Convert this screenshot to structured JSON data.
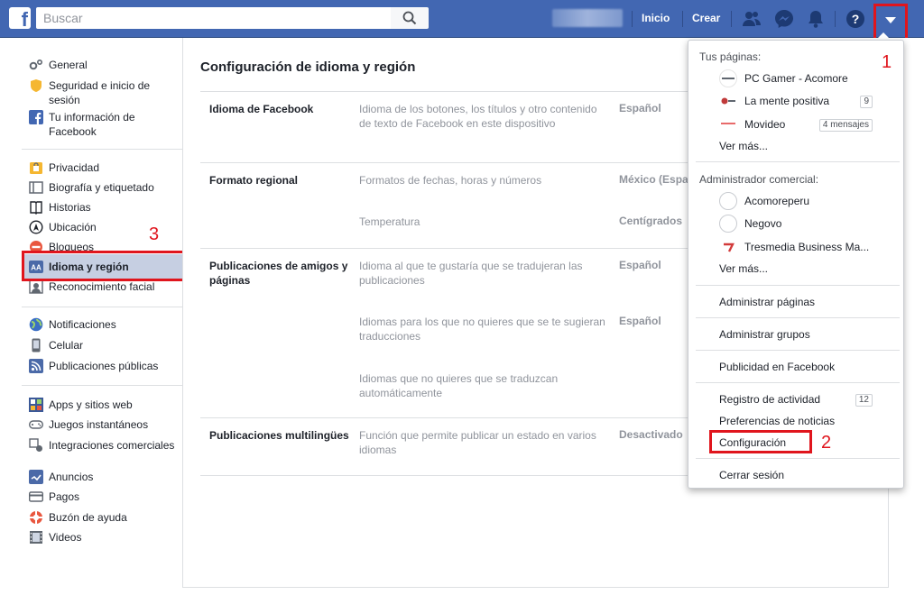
{
  "topbar": {
    "logo": "f",
    "search_placeholder": "Buscar",
    "nav_home": "Inicio",
    "nav_create": "Crear",
    "icons": [
      "friends-icon",
      "messenger-icon",
      "notifications-icon",
      "help-icon",
      "dropdown-caret-icon"
    ]
  },
  "sidebar": {
    "group1": [
      {
        "label": "General",
        "icon": "gear-icon"
      },
      {
        "label": "Seguridad e inicio de sesión",
        "icon": "shield-icon"
      },
      {
        "label": "Tu información de Facebook",
        "icon": "facebook-icon"
      }
    ],
    "group2": [
      {
        "label": "Privacidad",
        "icon": "lock-icon"
      },
      {
        "label": "Biografía y etiquetado",
        "icon": "timeline-icon"
      },
      {
        "label": "Historias",
        "icon": "book-icon"
      },
      {
        "label": "Ubicación",
        "icon": "location-icon"
      },
      {
        "label": "Bloqueos",
        "icon": "block-icon"
      },
      {
        "label": "Idioma y región",
        "icon": "language-icon"
      },
      {
        "label": "Reconocimiento facial",
        "icon": "face-icon"
      }
    ],
    "group3": [
      {
        "label": "Notificaciones",
        "icon": "globe-icon"
      },
      {
        "label": "Celular",
        "icon": "phone-icon"
      },
      {
        "label": "Publicaciones públicas",
        "icon": "rss-icon"
      }
    ],
    "group4": [
      {
        "label": "Apps y sitios web",
        "icon": "apps-icon"
      },
      {
        "label": "Juegos instantáneos",
        "icon": "gamepad-icon"
      },
      {
        "label": "Integraciones comerciales",
        "icon": "integration-icon"
      },
      {
        "label": "Anuncios",
        "icon": "ads-icon"
      },
      {
        "label": "Pagos",
        "icon": "card-icon"
      },
      {
        "label": "Buzón de ayuda",
        "icon": "lifebuoy-icon"
      },
      {
        "label": "Videos",
        "icon": "film-icon"
      }
    ]
  },
  "main": {
    "title": "Configuración de idioma y región",
    "rows": [
      {
        "label": "Idioma de Facebook",
        "desc": "Idioma de los botones, los títulos y otro contenido de texto de Facebook en este dispositivo",
        "value": "Español"
      },
      {
        "label": "Formato regional",
        "desc": "Formatos de fechas, horas y números",
        "value": "México (Español)"
      },
      {
        "label": "",
        "desc": "Temperatura",
        "value": "Centígrados"
      },
      {
        "label": "Publicaciones de amigos y páginas",
        "desc": "Idioma al que te gustaría que se tradujeran las publicaciones",
        "value": "Español"
      },
      {
        "label": "",
        "desc": "Idiomas para los que no quieres que se te sugieran traducciones",
        "value": "Español"
      },
      {
        "label": "",
        "desc": "Idiomas que no quieres que se traduzcan automáticamente",
        "value": ""
      },
      {
        "label": "Publicaciones multilingües",
        "desc": "Función que permite publicar un estado en varios idiomas",
        "value": "Desactivado"
      }
    ]
  },
  "menu": {
    "pages_heading": "Tus páginas:",
    "pages": [
      {
        "name": "PC Gamer - Acomore",
        "badge": ""
      },
      {
        "name": "La mente positiva",
        "badge": "9"
      },
      {
        "name": "Movideo",
        "badge": "4 mensajes"
      }
    ],
    "pages_more": "Ver más...",
    "business_heading": "Administrador comercial:",
    "business": [
      {
        "name": "Acomoreperu"
      },
      {
        "name": "Negovo"
      },
      {
        "name": "Tresmedia Business Ma..."
      }
    ],
    "business_more": "Ver más...",
    "manage_pages": "Administrar páginas",
    "manage_groups": "Administrar grupos",
    "advertising": "Publicidad en Facebook",
    "activity_log": "Registro de actividad",
    "activity_badge": "12",
    "news_prefs": "Preferencias de noticias",
    "settings": "Configuración",
    "logout": "Cerrar sesión"
  },
  "annotations": {
    "step1": "1",
    "step2": "2",
    "step3": "3"
  },
  "colors": {
    "brand": "#4267b2",
    "highlight": "#e0151d",
    "active_nav": "#c6cfe2"
  }
}
